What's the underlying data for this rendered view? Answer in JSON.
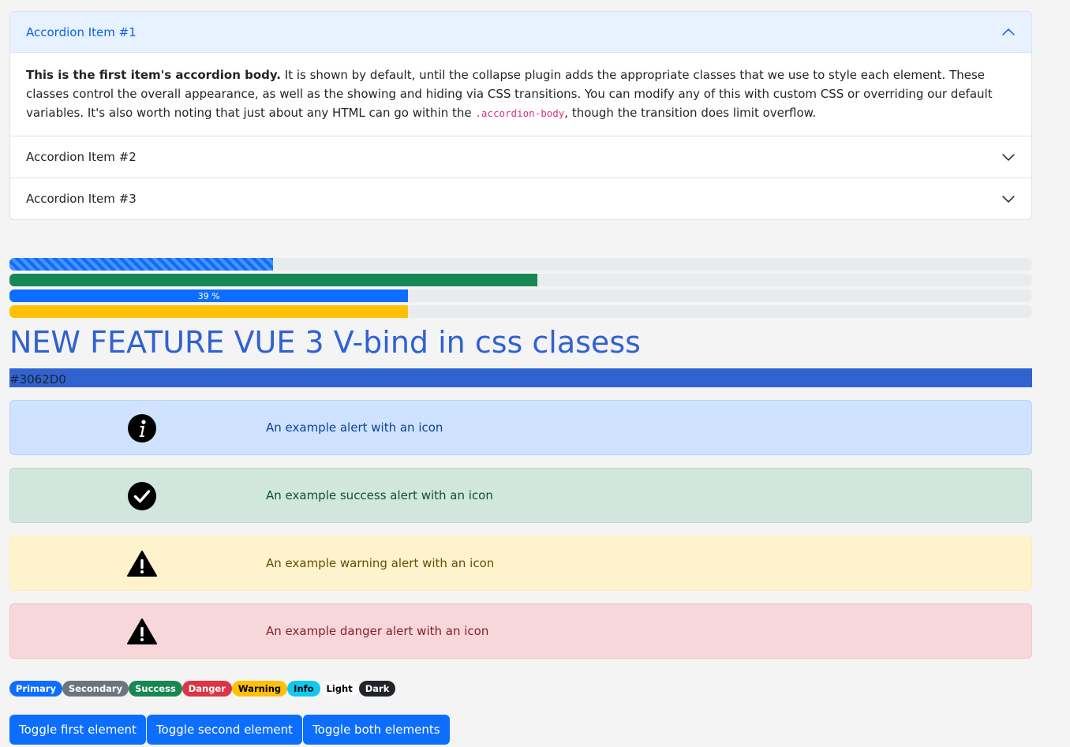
{
  "accordion": {
    "items": [
      {
        "title": "Accordion Item #1",
        "open": true,
        "body_strong": "This is the first item's accordion body.",
        "body_text": " It is shown by default, until the collapse plugin adds the appropriate classes that we use to style each element. These classes control the overall appearance, as well as the showing and hiding via CSS transitions. You can modify any of this with custom CSS or overriding our default variables. It's also worth noting that just about any HTML can go within the ",
        "body_code": ".accordion-body",
        "body_tail": ", though the transition does limit overflow."
      },
      {
        "title": "Accordion Item #2",
        "open": false
      },
      {
        "title": "Accordion Item #3",
        "open": false
      }
    ]
  },
  "progress": {
    "bars": [
      {
        "value": 0.258,
        "style": "striped",
        "color": "#0d6efd",
        "label": ""
      },
      {
        "value": 0.516,
        "style": "solid",
        "color": "#198754",
        "label": ""
      },
      {
        "value": 0.39,
        "style": "solid",
        "color": "#0d6efd",
        "label": "39 %"
      },
      {
        "value": 0.39,
        "style": "solid",
        "color": "#ffc107",
        "label": ""
      }
    ]
  },
  "headline": {
    "text": "NEW FEATURE VUE 3 V-bind in css clasess",
    "color": "#3062D0"
  },
  "color_bar": {
    "label": "#3062D0",
    "color": "#3062D0"
  },
  "alerts": [
    {
      "type": "primary",
      "icon": "info-icon",
      "message": "An example alert with an icon"
    },
    {
      "type": "success",
      "icon": "check-circle-icon",
      "message": "An example success alert with an icon"
    },
    {
      "type": "warning",
      "icon": "warning-triangle-icon",
      "message": "An example warning alert with an icon"
    },
    {
      "type": "danger",
      "icon": "warning-triangle-icon",
      "message": "An example danger alert with an icon"
    }
  ],
  "badges": [
    {
      "label": "Primary",
      "bg": "#0d6efd",
      "fg": "#ffffff"
    },
    {
      "label": "Secondary",
      "bg": "#6c757d",
      "fg": "#ffffff"
    },
    {
      "label": "Success",
      "bg": "#198754",
      "fg": "#ffffff"
    },
    {
      "label": "Danger",
      "bg": "#dc3545",
      "fg": "#ffffff"
    },
    {
      "label": "Warning",
      "bg": "#ffc107",
      "fg": "#000000"
    },
    {
      "label": "Info",
      "bg": "#0dcaf0",
      "fg": "#000000"
    },
    {
      "label": "Light",
      "bg": "#f8f9fa",
      "fg": "#000000"
    },
    {
      "label": "Dark",
      "bg": "#212529",
      "fg": "#ffffff"
    }
  ],
  "buttons": {
    "toggle_first": "Toggle first element",
    "toggle_second": "Toggle second element",
    "toggle_both": "Toggle both elements"
  }
}
